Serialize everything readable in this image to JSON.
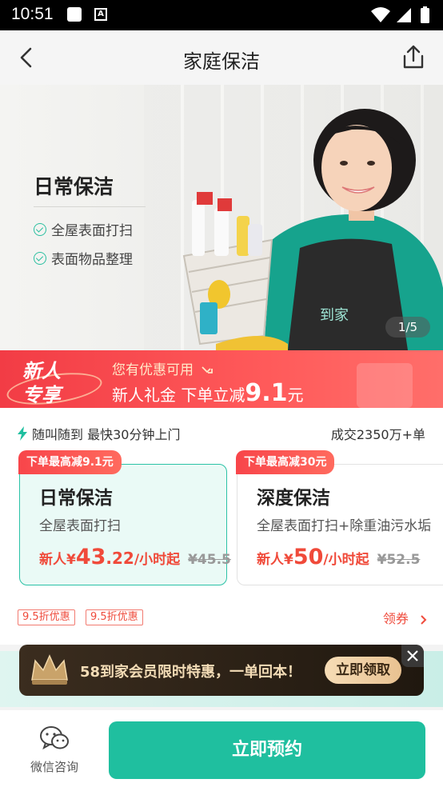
{
  "status_bar": {
    "time": "10:51",
    "app_icon_letter": "A"
  },
  "nav": {
    "title": "家庭保洁",
    "back_icon": "chevron-left-icon",
    "share_icon": "share-icon"
  },
  "banner": {
    "title": "日常保洁",
    "features": [
      "全屋表面打扫",
      "表面物品整理"
    ],
    "apron_text": "到家",
    "pager": "1/5"
  },
  "promo": {
    "badge_line1": "新人",
    "badge_line2": "专享",
    "subtitle": "您有优惠可用",
    "main_prefix": "新人礼金 下单立减",
    "amount": "9.1",
    "unit": "元"
  },
  "service": {
    "tagline": "随叫随到 最快30分钟上门",
    "deals": "成交2350万+单",
    "cards": [
      {
        "ribbon": "下单最高减9.1元",
        "name": "日常保洁",
        "desc": "全屋表面打扫",
        "price_prefix": "新人¥",
        "price_int": "43",
        "price_dec": ".22",
        "price_suffix": "/小时起",
        "original": "¥45.5",
        "selected": true
      },
      {
        "ribbon": "下单最高减30元",
        "name": "深度保洁",
        "desc": "全屋表面打扫+除重油污水垢",
        "price_prefix": "新人¥",
        "price_int": "50",
        "price_dec": "",
        "price_suffix": "/小时起",
        "original": "¥52.5",
        "selected": false
      }
    ],
    "discount_tags": [
      "9.5折优惠",
      "9.5折优惠"
    ],
    "coupon_link": "领券"
  },
  "member": {
    "text": "58到家会员限时特惠，一单回本！",
    "button": "立即领取"
  },
  "bottom": {
    "wechat_label": "微信咨询",
    "book_button": "立即预约"
  },
  "colors": {
    "accent": "#1fbf9f",
    "promo_red": "#f23c45",
    "price_red": "#f04a3a"
  }
}
